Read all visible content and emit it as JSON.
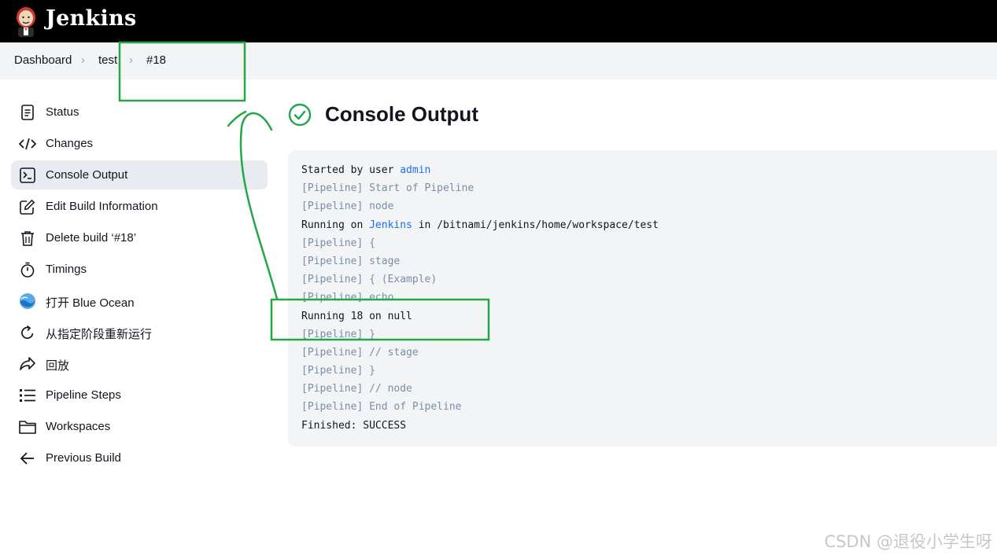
{
  "header": {
    "brand": "Jenkins",
    "logo_icon": "jenkins-butler-icon"
  },
  "breadcrumb": {
    "items": [
      {
        "label": "Dashboard"
      },
      {
        "label": "test"
      },
      {
        "label": "#18"
      }
    ],
    "separator_icon": "chevron-right-icon"
  },
  "sidebar": {
    "items": [
      {
        "label": "Status",
        "icon": "document-icon"
      },
      {
        "label": "Changes",
        "icon": "code-icon"
      },
      {
        "label": "Console Output",
        "icon": "terminal-icon",
        "active": true
      },
      {
        "label": "Edit Build Information",
        "icon": "edit-icon"
      },
      {
        "label": "Delete build ‘#18’",
        "icon": "trash-icon"
      },
      {
        "label": "Timings",
        "icon": "stopwatch-icon"
      },
      {
        "label": "打开 Blue Ocean",
        "icon": "blue-ocean-icon"
      },
      {
        "label": "从指定阶段重新运行",
        "icon": "restart-icon"
      },
      {
        "label": "回放",
        "icon": "replay-icon"
      },
      {
        "label": "Pipeline Steps",
        "icon": "list-icon"
      },
      {
        "label": "Workspaces",
        "icon": "folder-icon"
      },
      {
        "label": "Previous Build",
        "icon": "arrow-left-icon"
      }
    ]
  },
  "main": {
    "title": "Console Output",
    "status_icon": "success-check-icon",
    "console_lines": [
      {
        "parts": [
          {
            "t": "Started by user ",
            "k": "plain"
          },
          {
            "t": "admin",
            "k": "link"
          }
        ]
      },
      {
        "parts": [
          {
            "t": "[Pipeline] Start of Pipeline",
            "k": "pipe"
          }
        ]
      },
      {
        "parts": [
          {
            "t": "[Pipeline] node",
            "k": "pipe"
          }
        ]
      },
      {
        "parts": [
          {
            "t": "Running on ",
            "k": "plain"
          },
          {
            "t": "Jenkins",
            "k": "link"
          },
          {
            "t": " in /bitnami/jenkins/home/workspace/test",
            "k": "plain"
          }
        ]
      },
      {
        "parts": [
          {
            "t": "[Pipeline] {",
            "k": "pipe"
          }
        ]
      },
      {
        "parts": [
          {
            "t": "[Pipeline] stage",
            "k": "pipe"
          }
        ]
      },
      {
        "parts": [
          {
            "t": "[Pipeline] { (Example)",
            "k": "pipe"
          }
        ]
      },
      {
        "parts": [
          {
            "t": "[Pipeline] echo",
            "k": "pipe"
          }
        ]
      },
      {
        "parts": [
          {
            "t": "Running 18 on null",
            "k": "plain"
          }
        ]
      },
      {
        "parts": [
          {
            "t": "[Pipeline] }",
            "k": "pipe"
          }
        ]
      },
      {
        "parts": [
          {
            "t": "[Pipeline] // stage",
            "k": "pipe"
          }
        ]
      },
      {
        "parts": [
          {
            "t": "[Pipeline] }",
            "k": "pipe"
          }
        ]
      },
      {
        "parts": [
          {
            "t": "[Pipeline] // node",
            "k": "pipe"
          }
        ]
      },
      {
        "parts": [
          {
            "t": "[Pipeline] End of Pipeline",
            "k": "pipe"
          }
        ]
      },
      {
        "parts": [
          {
            "t": "Finished: SUCCESS",
            "k": "plain"
          }
        ]
      }
    ]
  },
  "watermark": "CSDN @退役小学生呀",
  "colors": {
    "header_bg": "#000000",
    "success": "#1ea64b",
    "annotation": "#22a845",
    "link": "#1f6feb",
    "pipeline_text": "#7a8ea8"
  }
}
